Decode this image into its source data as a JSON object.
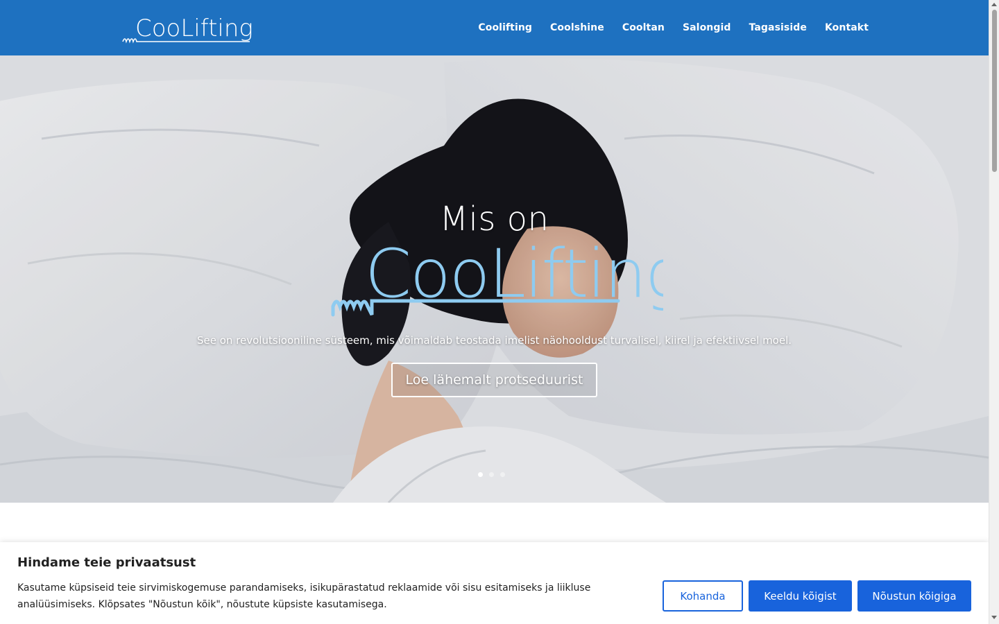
{
  "header": {
    "logo_text": "CooLifting",
    "nav": [
      {
        "label": "Coolifting"
      },
      {
        "label": "Coolshine"
      },
      {
        "label": "Cooltan"
      },
      {
        "label": "Salongid"
      },
      {
        "label": "Tagasiside"
      },
      {
        "label": "Kontakt"
      }
    ]
  },
  "hero": {
    "title": "Mis on",
    "logo_text": "CooLifting",
    "subtitle": "See on revolutsiooniline süsteem, mis võimaldab teostada imelist näohooldust turvalisel, kiirel ja efektiivsel moel.",
    "button_label": "Loe lähemalt protseduurist",
    "slides_count": 3,
    "active_slide": 1
  },
  "cookie": {
    "title": "Hindame teie privaatsust",
    "text": "Kasutame küpsiseid teie sirvimiskogemuse parandamiseks, isikupärastatud reklaamide või sisu esitamiseks ja liikluse analüüsimiseks. Klõpsates \"Nõustun kõik\", nõustute küpsiste kasutamisega.",
    "customize_label": "Kohanda",
    "reject_label": "Keeldu kõigist",
    "accept_label": "Nõustun kõigiga"
  },
  "colors": {
    "header_bg": "#1e71c0",
    "cookie_button": "#1863dc",
    "hero_logo_light": "#8ecbf0",
    "hero_logo_dark": "#5aaee0"
  }
}
